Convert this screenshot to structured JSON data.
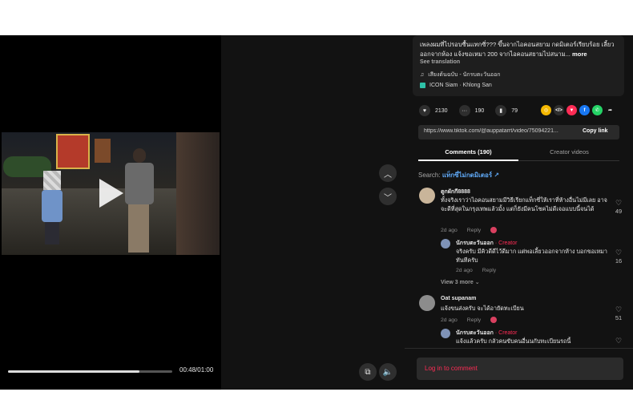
{
  "video": {
    "time": "00:48/01:00",
    "progress_fraction": 0.8
  },
  "description": {
    "text": "เพลงผมที่ไปรอบซื้นแทกซี่??? ขึ้นจากไอคอนสยาม กดมิเตอร์เรียบร้อย เลี้ยวออกจากห้อง แจ้งขอเหมา 200 จากไอคอนสยามไปสนาม...",
    "more": "more",
    "see_translation": "See translation",
    "music": "เสียงต้นฉบับ - นักรบตะวันออก",
    "location": "ICON Siam · Khlong San"
  },
  "actions": {
    "likes": "2130",
    "comments": "190",
    "saves": "79"
  },
  "share_icons": [
    {
      "name": "coin",
      "glyph": "◎",
      "color": "#f5b800"
    },
    {
      "name": "embed",
      "glyph": "</>",
      "color": "#2e2e2e"
    },
    {
      "name": "send",
      "glyph": "▼",
      "color": "#fe2c55"
    },
    {
      "name": "facebook",
      "glyph": "f",
      "color": "#1877f2"
    },
    {
      "name": "whatsapp",
      "glyph": "✆",
      "color": "#25d366"
    },
    {
      "name": "share-arrow",
      "glyph": "➦",
      "color": "#121212"
    }
  ],
  "link": {
    "url": "https://www.tiktok.com/@auppatarrt/video/75094221...",
    "copy_label": "Copy link"
  },
  "tabs": {
    "comments": "Comments (190)",
    "creator_videos": "Creator videos"
  },
  "search": {
    "label": "Search:",
    "query": "แท็กซี่ไม่กดมิเตอร์"
  },
  "comments": [
    {
      "user": "ตูกผักกี8888",
      "text": "ทั้งจริงเราว่าไอคอนสยามมีวิธีเรียกแท็กซี่ให้เราที่ห้างอื่นไม่มีเลย อาจจะดีที่สุดในกรุงเทพแล้วมั้ง แต่ก็ยังมีคนโชคไม่ดีเจอแบบนี้จนได้",
      "date": "2d ago",
      "reply": "Reply",
      "likes": "49",
      "avatar_color": "#c9b59a"
    },
    {
      "user": "นักรบตะวันออก",
      "creator_tag": "· Creator",
      "text": "จริงครับ มีคิวดีดีไว้ดีมาก แต่พอเลี้ยวออกจากห้าง บอกขอเหมาทันทีครับ",
      "date": "2d ago",
      "reply": "Reply",
      "likes": "16",
      "avatar_color": "#7f93b7"
    },
    {
      "view_more": "View 3 more"
    },
    {
      "user": "Oat supanam",
      "text": "แจ้งขนส่งครับ จะได้อายัดทะเบียน",
      "date": "2d ago",
      "reply": "Reply",
      "likes": "51",
      "avatar_color": "#8c8c8c"
    },
    {
      "user": "นักรบตะวันออก",
      "creator_tag": "· Creator",
      "text": "แจ้งแล้วครับ กลัวคนขับคนอื่นนกับทะเบียนรถนี้",
      "likes": "",
      "avatar_color": "#7f93b7"
    }
  ],
  "login": {
    "label": "Log in to comment"
  }
}
